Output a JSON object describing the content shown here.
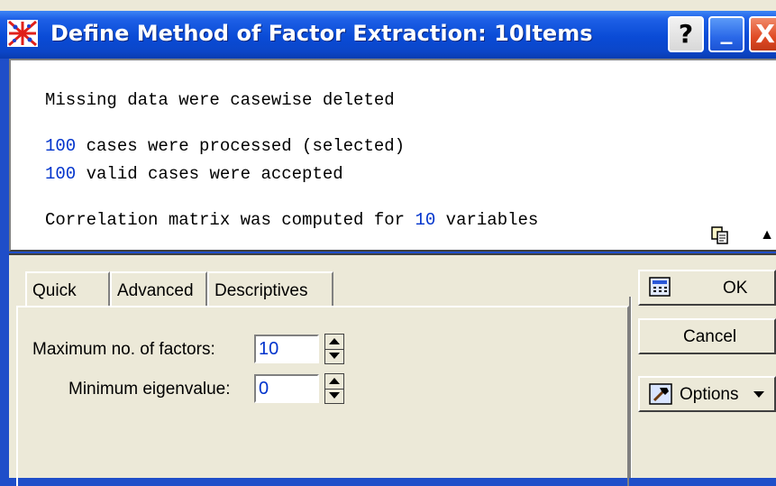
{
  "titlebar": {
    "title": "Define Method of Factor Extraction: 10Items",
    "help_label": "?",
    "minimize_label": "_",
    "close_label": "X"
  },
  "output": {
    "line1": "Missing data were casewise deleted",
    "line2_num": "100",
    "line2_text": " cases were processed (selected)",
    "line3_num": "100",
    "line3_text": " valid cases were accepted",
    "line4_pre": "Correlation matrix was computed for ",
    "line4_num": "10",
    "line4_post": " variables"
  },
  "tabs": [
    {
      "label": "Quick",
      "active": true
    },
    {
      "label": "Advanced",
      "active": false
    },
    {
      "label": "Descriptives",
      "active": false
    }
  ],
  "quick": {
    "max_factors_label": "Maximum no. of factors:",
    "max_factors_value": "10",
    "min_eigen_label": "Minimum eigenvalue:",
    "min_eigen_value": "0"
  },
  "buttons": {
    "ok": "OK",
    "cancel": "Cancel",
    "options": "Options"
  },
  "colors": {
    "titlebar": "#0a4bd6",
    "number_text": "#0033cc",
    "dialog_bg": "#ece9d8"
  }
}
